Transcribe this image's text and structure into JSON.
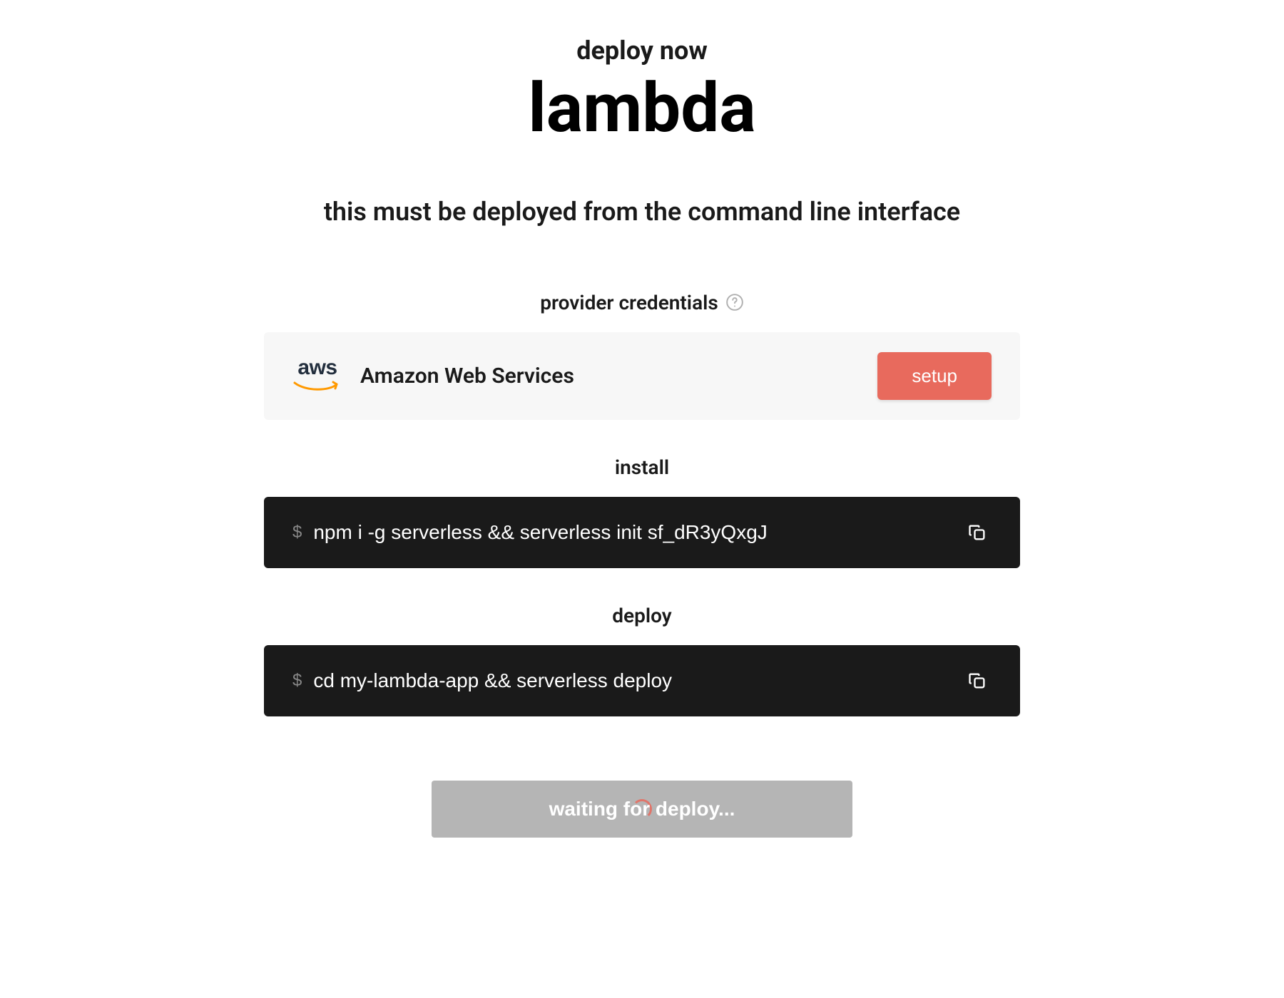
{
  "header": {
    "pre_title": "deploy now",
    "title": "lambda",
    "subtitle": "this must be deployed from the command line interface"
  },
  "credentials": {
    "section_label": "provider credentials",
    "provider_name": "Amazon Web Services",
    "provider_logo_text": "aws",
    "setup_label": "setup"
  },
  "install": {
    "section_label": "install",
    "prompt": "$",
    "command": "npm i -g serverless && serverless init sf_dR3yQxgJ"
  },
  "deploy": {
    "section_label": "deploy",
    "prompt": "$",
    "command": "cd my-lambda-app && serverless deploy"
  },
  "status": {
    "waiting_label": "waiting for deploy..."
  }
}
